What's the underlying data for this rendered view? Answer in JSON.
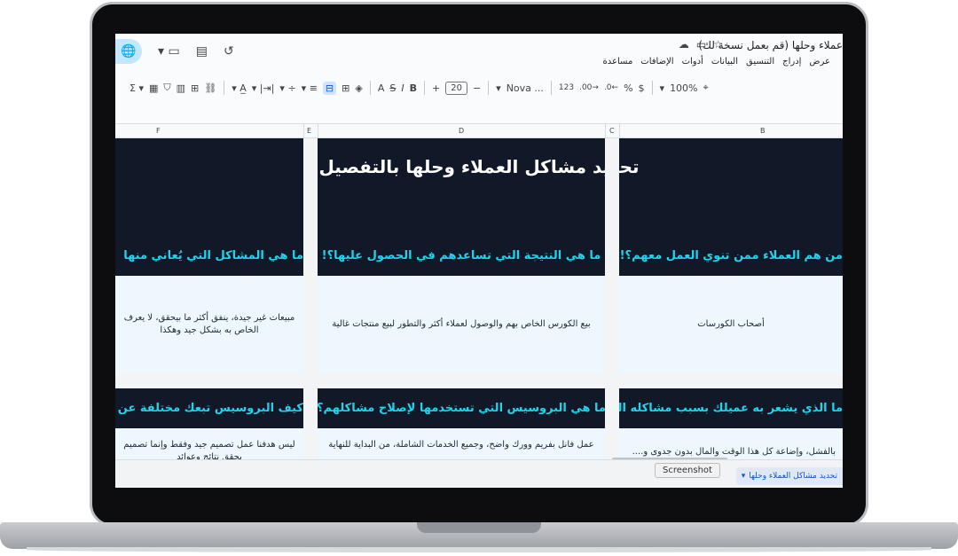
{
  "document": {
    "title": "عملاء وحلها (قم بعمل نسخة لك)",
    "menu": [
      "عرض",
      "إدراج",
      "التنسيق",
      "البيانات",
      "أدوات",
      "الإضافات",
      "مساعدة"
    ]
  },
  "toolbar": {
    "zoom": "100%",
    "currency": "$",
    "percent": "%",
    "dec_decrease": ".0←",
    "dec_increase": ".00→",
    "number_format": "123",
    "font": "Nova ...",
    "font_size": "20",
    "minus": "−",
    "plus": "+",
    "bold": "B",
    "italic": "I",
    "strike": "S",
    "text_color": "A"
  },
  "columns": [
    "F",
    "E",
    "D",
    "C",
    "B"
  ],
  "sheet": {
    "title": "تحديد مشاكل العملاء وحلها بالتفصيل",
    "row1": {
      "b_question": "من هم العملاء ممن تنوي العمل معهم؟!",
      "d_question": "ما هي النتيجة التي تساعدهم في الحصول عليها؟!",
      "f_question": "ما هي المشاكل التي يُعاني منها",
      "b_answer": "أصحاب الكورسات",
      "d_answer": "بيع الكورس الخاص بهم والوصول لعملاء أكثر والتطور لبيع منتجات غالية",
      "f_answer": "مبيعات غير جيدة، ينفق أكثر ما بيحقق، لا يعرف الخاص به بشكل جيد وهكذا"
    },
    "row2": {
      "b_question": "ما الذي يشعر به عميلك بسبب مشاكله السابقة؟",
      "d_question": "ما هي البروسيس التي تستخدمها لإصلاح مشاكلهم؟",
      "f_question": "كيف البروسيس تبعك مختلفة عن",
      "b_answer": "بالفشل، وإضاعة كل هذا الوقت والمال بدون جدوى و....",
      "d_answer": "عمل فانل بفريم وورك واضح، وجميع الخدمات الشاملة، من البداية للنهاية",
      "f_answer": "ليس هدفنا عمل تصميم جيد وفقط وإنما تصميم يحقق نتائج وعوائد"
    }
  },
  "sheet_tab": "تحديد مشاكل العملاء وحلها",
  "tooltip": "Screenshot"
}
